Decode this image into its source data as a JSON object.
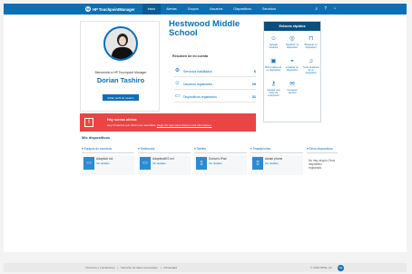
{
  "header": {
    "brand": "HP TouchpointManager",
    "brand_logo": "hp",
    "nav": [
      "Inicio",
      "Alertas",
      "Grupos",
      "Usuarios",
      "Dispositivos",
      "Servicios"
    ],
    "icons": [
      "search-icon",
      "help-icon",
      "user-icon"
    ]
  },
  "profile": {
    "welcome": "Bienvenido a HP Touchpoint Manager",
    "name": "Dorian Tashiro",
    "edit_label": "Editar perfil de usuario"
  },
  "school": {
    "title": "Hestwood Middle School"
  },
  "summary": {
    "title": "Resumen de mi cuenta",
    "rows": [
      {
        "label": "Servicios habilitados",
        "value": "6",
        "icon": "services-icon"
      },
      {
        "label": "Usuarios registrados",
        "value": "20",
        "icon": "users-icon"
      },
      {
        "label": "Dispositivos registrados",
        "value": "31",
        "icon": "devices-icon"
      }
    ]
  },
  "quick_links": {
    "title": "Enlaces rápidos",
    "items": [
      {
        "label": "Agregar usuarios",
        "icon": "add-user-icon"
      },
      {
        "label": "Registrar mi dispositivo",
        "icon": "register-icon"
      },
      {
        "label": "Bloquear un dispositivo",
        "icon": "lock-icon"
      },
      {
        "label": "Borrar datos de un dispositivo",
        "icon": "erase-icon"
      },
      {
        "label": "Localizar un dispositivo",
        "icon": "locate-icon"
      },
      {
        "label": "Tocar la alarma de un dispositivo",
        "icon": "alarm-icon"
      },
      {
        "label": "Agregar una clave de suscripción",
        "icon": "key-icon"
      },
      {
        "label": "Contactar servicio",
        "icon": "contact-icon"
      }
    ]
  },
  "alert": {
    "title": "Hay nuevas alertas",
    "text": "Hay 10 alertas que deben ser atendidas.",
    "link": "Haga clic aquí para obtener más información."
  },
  "devices": {
    "title": "Mis dispositivos",
    "categories": [
      {
        "name": "Equipos de escritorio",
        "device": "Adaptiob m4",
        "link": "Ver detalles"
      },
      {
        "name": "Notebooks",
        "device": "Adaptivab07-m4",
        "link": "Ver detalles"
      },
      {
        "name": "Tablets",
        "device": "Dorian's iPad",
        "link": "Ver detalles"
      },
      {
        "name": "Smartphones",
        "device": "dorian phone",
        "link": "Ver detalles"
      },
      {
        "name": "Otros dispositivos",
        "none_text": "No hay ningún Otros dispositivo registrado."
      }
    ]
  },
  "footer": {
    "links": [
      "Términos y condiciones",
      "|",
      "Derecho de datos personales",
      "|",
      "Privacidad"
    ],
    "copyright": "© 2015 HPNL LP"
  },
  "colors": {
    "primary": "#0b6fb5",
    "dark": "#0b4e7e",
    "alert": "#e94545"
  }
}
